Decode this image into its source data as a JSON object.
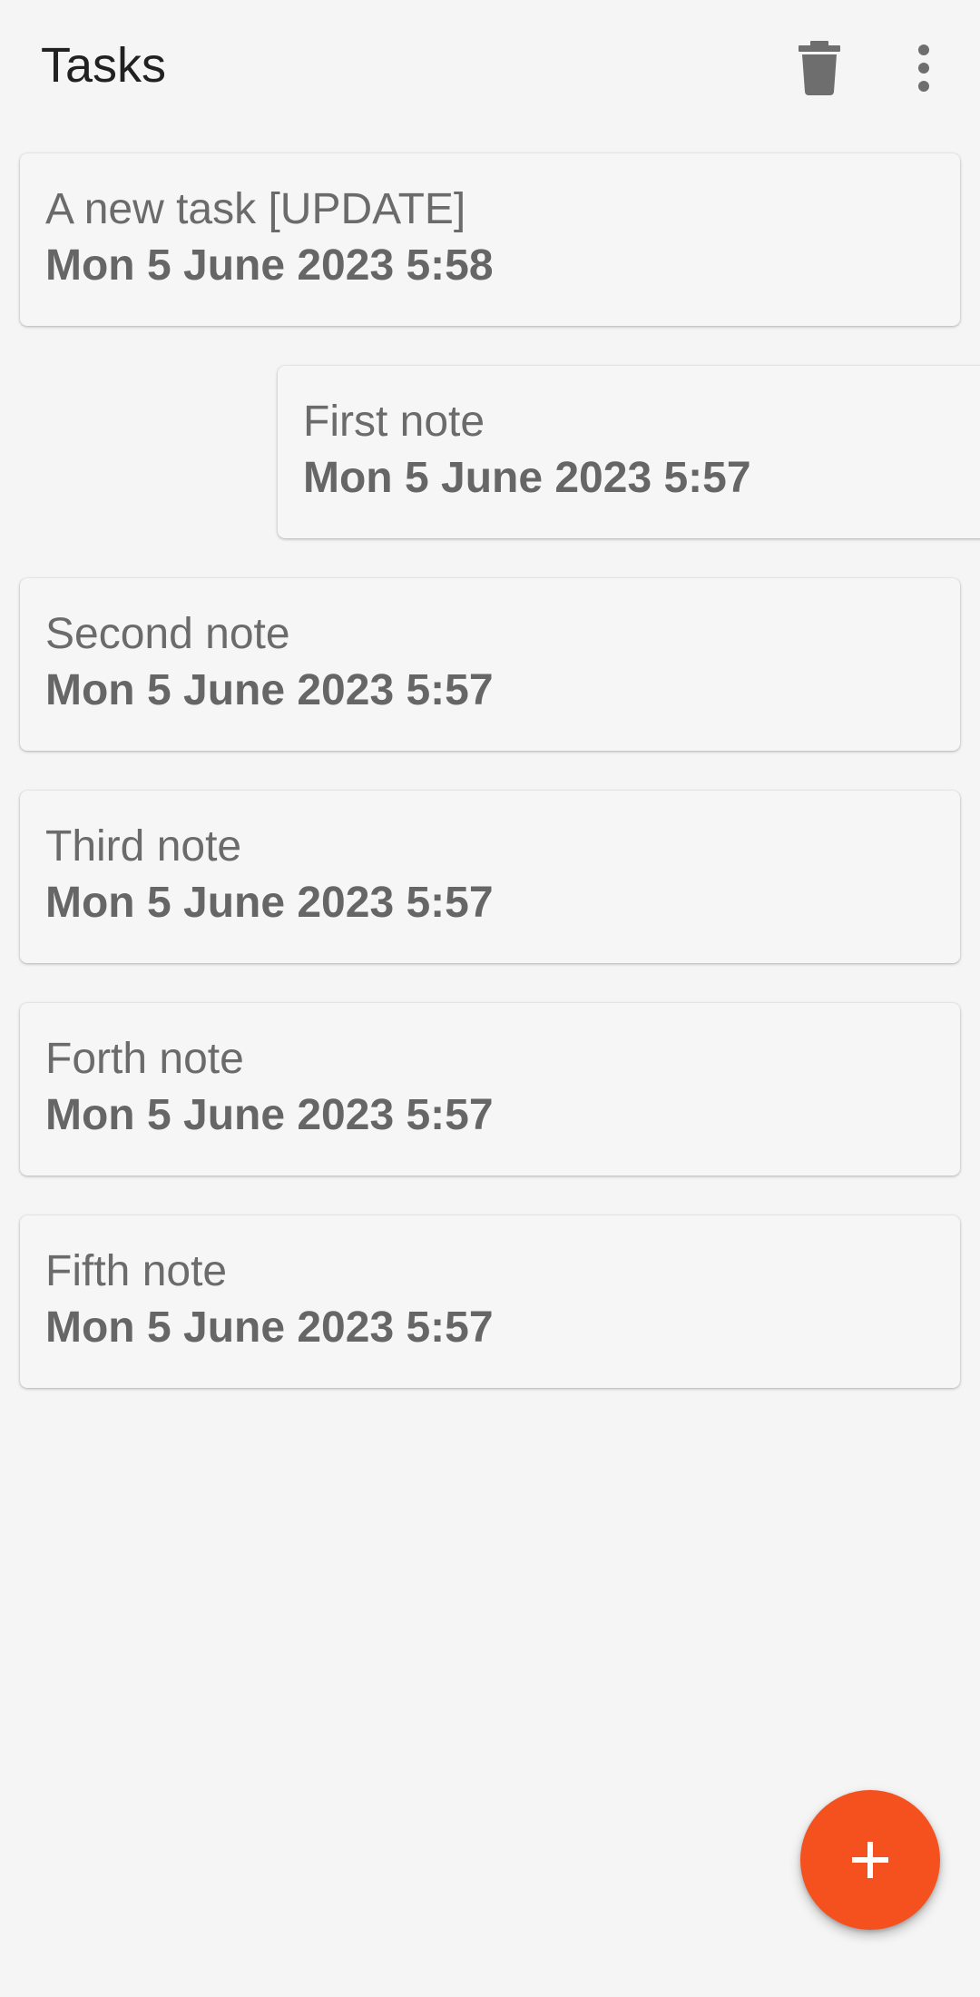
{
  "app_bar": {
    "title": "Tasks",
    "actions": [
      {
        "icon": "delete-icon"
      },
      {
        "icon": "more-vert-icon"
      }
    ]
  },
  "tasks": [
    {
      "title": "A new task [UPDATE]",
      "date": "Mon 5 June 2023 5:58"
    },
    {
      "title": "First note",
      "date": "Mon 5 June 2023 5:57"
    },
    {
      "title": "Second note",
      "date": "Mon 5 June 2023 5:57"
    },
    {
      "title": "Third note",
      "date": "Mon 5 June 2023 5:57"
    },
    {
      "title": "Forth note",
      "date": "Mon 5 June 2023 5:57"
    },
    {
      "title": "Fifth note",
      "date": "Mon 5 June 2023 5:57"
    }
  ],
  "fab": {
    "icon": "plus-icon"
  },
  "colors": {
    "accent": "#f4511e",
    "background": "#f5f5f5",
    "card": "#f6f6f6",
    "icon": "#6e6e6e"
  }
}
